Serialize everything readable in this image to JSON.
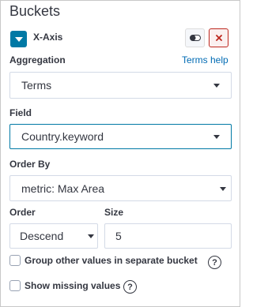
{
  "panel": {
    "heading": "Buckets"
  },
  "agg": {
    "title": "X-Axis",
    "toggle_icon": "toggle-switch-icon",
    "remove_icon": "close-icon",
    "collapse_icon": "chevron-down-icon"
  },
  "aggregation": {
    "label": "Aggregation",
    "help_link": "Terms help",
    "value": "Terms"
  },
  "field": {
    "label": "Field",
    "value": "Country.keyword"
  },
  "order_by": {
    "label": "Order By",
    "value": "metric: Max Area"
  },
  "order": {
    "label": "Order",
    "value": "Descend"
  },
  "size": {
    "label": "Size",
    "value": "5"
  },
  "options": {
    "group_other": "Group other values in separate bucket",
    "show_missing": "Show missing values",
    "help_glyph": "?"
  },
  "colors": {
    "accent": "#0079a5",
    "link": "#006bb4",
    "danger": "#bd271e",
    "text": "#343741"
  }
}
